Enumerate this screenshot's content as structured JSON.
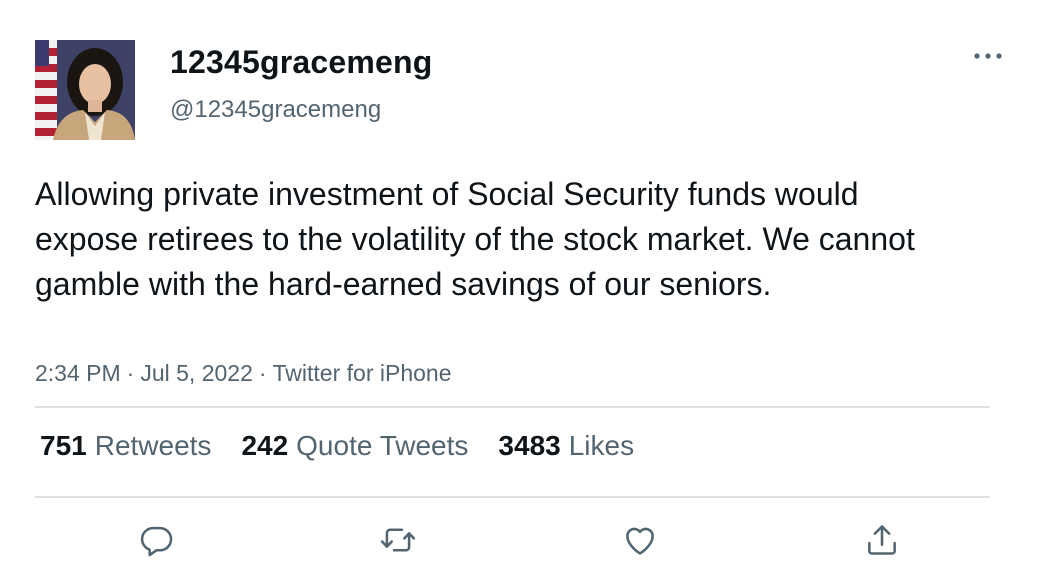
{
  "tweet": {
    "display_name": "12345gracemeng",
    "handle": "@12345gracemeng",
    "text": "Allowing private investment of Social Security funds would expose retirees to the volatility of the stock market. We cannot gamble with the hard-earned savings of our seniors.",
    "time": "2:34 PM",
    "date": "Jul 5, 2022",
    "source": "Twitter for iPhone",
    "separator": "·"
  },
  "stats": {
    "retweets_count": "751",
    "retweets_label": "Retweets",
    "quotes_count": "242",
    "quotes_label": "Quote Tweets",
    "likes_count": "3483",
    "likes_label": "Likes"
  },
  "icons": {
    "more": "more-horizontal-icon",
    "reply": "reply-icon",
    "retweet": "retweet-icon",
    "like": "heart-icon",
    "share": "share-icon"
  },
  "colors": {
    "text_primary": "#0f1419",
    "text_secondary": "#536471",
    "divider": "#dcdfe3",
    "icon": "#536471"
  }
}
